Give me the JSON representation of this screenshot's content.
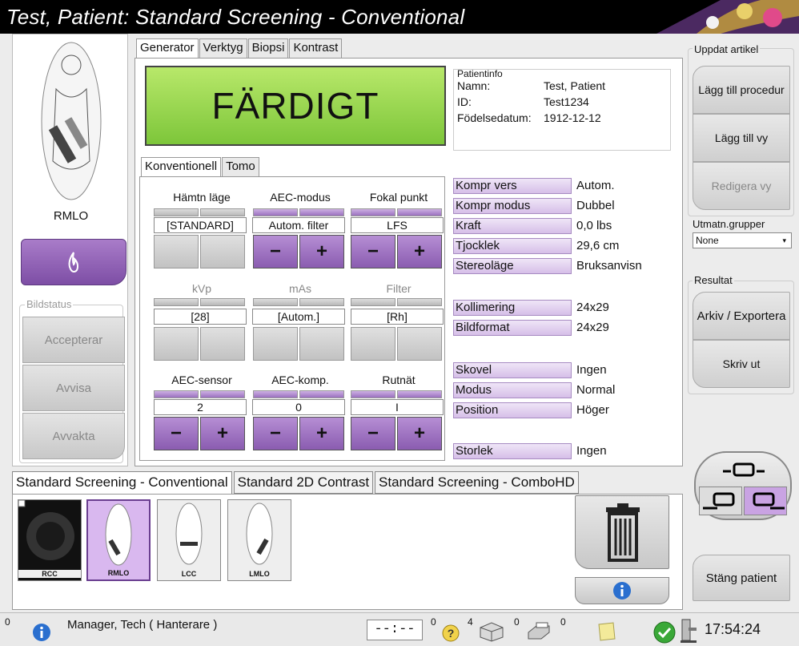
{
  "title": "Test, Patient:  Standard Screening - Conventional",
  "left": {
    "view_label": "RMLO",
    "bildstatus_legend": "Bildstatus",
    "buttons": [
      "Accepterar",
      "Avvisa",
      "Avvakta"
    ]
  },
  "tabs": [
    "Generator",
    "Verktyg",
    "Biopsi",
    "Kontrast"
  ],
  "status_text": "FÄRDIGT",
  "patient_info": {
    "legend": "Patientinfo",
    "name_label": "Namn:",
    "name": "Test, Patient",
    "id_label": "ID:",
    "id": "Test1234",
    "dob_label": "Födelsedatum:",
    "dob": "1912-12-12"
  },
  "subtabs": [
    "Konventionell",
    "Tomo"
  ],
  "controls": {
    "hamtn_label": "Hämtn läge",
    "hamtn_value": "[STANDARD]",
    "aec_modus_label": "AEC-modus",
    "aec_modus_value": "Autom. filter",
    "fokal_label": "Fokal punkt",
    "fokal_value": "LFS",
    "kvp_label": "kVp",
    "kvp_value": "[28]",
    "mas_label": "mAs",
    "mas_value": "[Autom.]",
    "filter_label": "Filter",
    "filter_value": "[Rh]",
    "aec_sensor_label": "AEC-sensor",
    "aec_sensor_value": "2",
    "aec_komp_label": "AEC-komp.",
    "aec_komp_value": "0",
    "rutnat_label": "Rutnät",
    "rutnat_value": "I",
    "minus": "−",
    "plus": "+"
  },
  "properties": [
    {
      "key": "Kompr vers",
      "value": "Autom."
    },
    {
      "key": "Kompr modus",
      "value": "Dubbel"
    },
    {
      "key": "Kraft",
      "value": "0,0 lbs"
    },
    {
      "key": "Tjocklek",
      "value": "29,6 cm"
    },
    {
      "key": "Stereoläge",
      "value": "Bruksanvisn"
    },
    {
      "key": "Kollimering",
      "value": "24x29"
    },
    {
      "key": "Bildformat",
      "value": "24x29"
    },
    {
      "key": "Skovel",
      "value": "Ingen"
    },
    {
      "key": "Modus",
      "value": "Normal"
    },
    {
      "key": "Position",
      "value": "Höger"
    },
    {
      "key": "Storlek",
      "value": "Ingen"
    }
  ],
  "right": {
    "uppdat_legend": "Uppdat artikel",
    "lagg_procedur": "Lägg till procedur",
    "lagg_vy": "Lägg till vy",
    "redigera_vy": "Redigera vy",
    "utmatn_legend": "Utmatn.grupper",
    "utmatn_value": "None",
    "resultat_legend": "Resultat",
    "arkiv": "Arkiv / Exportera",
    "skriv_ut": "Skriv ut",
    "stang": "Stäng patient"
  },
  "procedure_tabs": [
    "Standard Screening - Conventional",
    "Standard 2D Contrast",
    "Standard Screening - ComboHD"
  ],
  "thumbnails": [
    "RCC",
    "RMLO",
    "LCC",
    "LMLO"
  ],
  "statusbar": {
    "count_left": "0",
    "user": "Manager, Tech ( Hanterare )",
    "timer": "--:--",
    "count_help": "0",
    "count_box": "4",
    "count_print": "0",
    "count_notes": "0",
    "clock": "17:54:24"
  },
  "colors": {
    "ready_green": "#8fd24a",
    "accent_purple": "#9b6cc0",
    "prop_key_bg": "#e3d3ef"
  }
}
